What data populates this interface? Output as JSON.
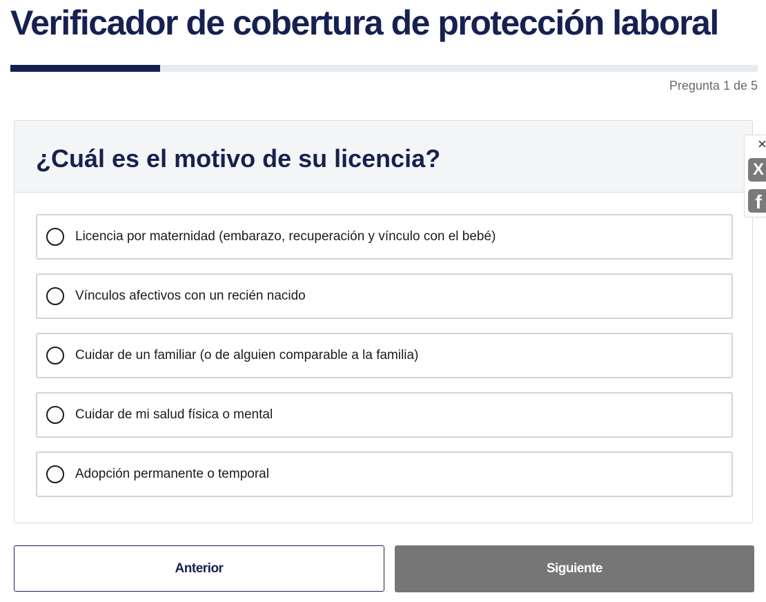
{
  "page": {
    "title": "Verificador de cobertura de protección laboral"
  },
  "progress": {
    "text": "Pregunta 1 de 5",
    "fraction": 0.2
  },
  "question": {
    "text": "¿Cuál es el motivo de su licencia?",
    "options": [
      {
        "label": "Licencia por maternidad (embarazo, recuperación y vínculo con el bebé)",
        "selected": false
      },
      {
        "label": "Vínculos afectivos con un recién nacido",
        "selected": false
      },
      {
        "label": "Cuidar de un familiar (o de alguien comparable a la familia)",
        "selected": false
      },
      {
        "label": "Cuidar de mi salud física o mental",
        "selected": false
      },
      {
        "label": "Adopción permanente o temporal",
        "selected": false
      }
    ]
  },
  "nav": {
    "prev_label": "Anterior",
    "next_label": "Siguiente"
  },
  "share": {
    "close": "×",
    "x_icon": "X",
    "facebook_icon": "f"
  },
  "colors": {
    "brand": "#162151",
    "disabled_button": "#767676",
    "progress_track": "#e7eaee"
  }
}
